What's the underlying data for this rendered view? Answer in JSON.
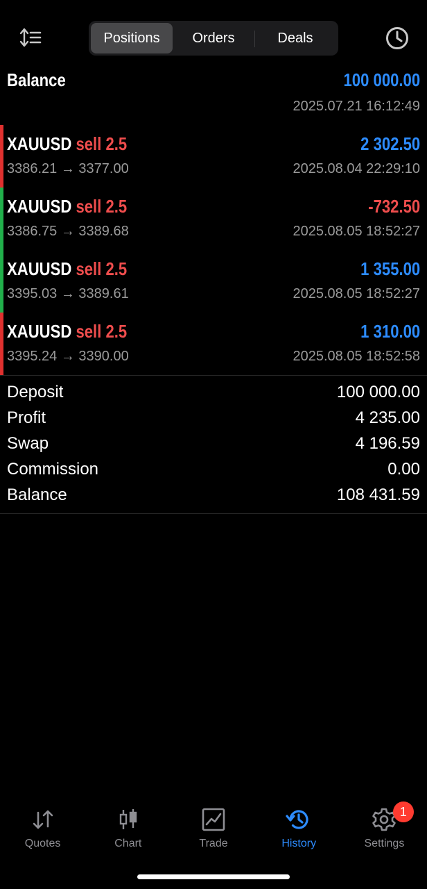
{
  "header": {
    "segments": [
      {
        "label": "Positions",
        "active": true
      },
      {
        "label": "Orders",
        "active": false
      },
      {
        "label": "Deals",
        "active": false
      }
    ],
    "left_icon": "sort-icon",
    "right_icon": "clock-icon"
  },
  "balance_entry": {
    "title": "Balance",
    "amount": "100 000.00",
    "time": "2025.07.21 16:12:49"
  },
  "trades": [
    {
      "symbol": "XAUUSD",
      "side": "sell 2.5",
      "profit": "2 302.50",
      "profit_sign": "positive",
      "prices": "3386.21 → 3377.00",
      "time": "2025.08.04 22:29:10",
      "stripe": "#e0312f"
    },
    {
      "symbol": "XAUUSD",
      "side": "sell 2.5",
      "profit": "-732.50",
      "profit_sign": "negative",
      "prices": "3386.75 → 3389.68",
      "time": "2025.08.05 18:52:27",
      "stripe": "#21b04b"
    },
    {
      "symbol": "XAUUSD",
      "side": "sell 2.5",
      "profit": "1 355.00",
      "profit_sign": "positive",
      "prices": "3395.03 → 3389.61",
      "time": "2025.08.05 18:52:27",
      "stripe": "#21b04b"
    },
    {
      "symbol": "XAUUSD",
      "side": "sell 2.5",
      "profit": "1 310.00",
      "profit_sign": "positive",
      "prices": "3395.24 → 3390.00",
      "time": "2025.08.05 18:52:58",
      "stripe": "#e0312f"
    }
  ],
  "summary": {
    "deposit": {
      "label": "Deposit",
      "value": "100 000.00"
    },
    "profit": {
      "label": "Profit",
      "value": "4 235.00"
    },
    "swap": {
      "label": "Swap",
      "value": "4 196.59"
    },
    "commission": {
      "label": "Commission",
      "value": "0.00"
    },
    "balance": {
      "label": "Balance",
      "value": "108 431.59"
    }
  },
  "tabbar": {
    "tabs": [
      {
        "label": "Quotes",
        "icon": "quotes-icon",
        "active": false
      },
      {
        "label": "Chart",
        "icon": "candlestick-icon",
        "active": false
      },
      {
        "label": "Trade",
        "icon": "trade-chart-icon",
        "active": false
      },
      {
        "label": "History",
        "icon": "history-icon",
        "active": true
      },
      {
        "label": "Settings",
        "icon": "gear-icon",
        "active": false,
        "badge": "1"
      }
    ]
  },
  "colors": {
    "accent_blue": "#2d8cff",
    "loss_red": "#ef4d4d",
    "stripe_red": "#e0312f",
    "stripe_green": "#21b04b",
    "muted_gray": "#9a9a9a"
  }
}
